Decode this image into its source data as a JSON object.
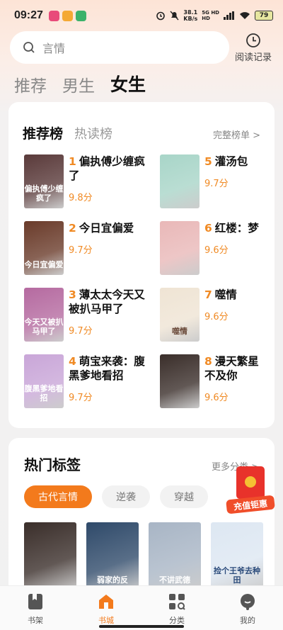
{
  "status_bar": {
    "time": "09:27",
    "net_speed_value": "38.1",
    "net_speed_unit": "KB/s",
    "signal_top": "5G HD",
    "signal_bottom": "HD",
    "battery": "79"
  },
  "search": {
    "placeholder": "言情",
    "history_label": "阅读记录"
  },
  "channel_tabs": [
    {
      "label": "推荐",
      "active": false
    },
    {
      "label": "男生",
      "active": false
    },
    {
      "label": "女生",
      "active": true
    }
  ],
  "rank_card": {
    "tabs": [
      "推荐榜",
      "热读榜"
    ],
    "more_label": "完整榜单 >",
    "items": [
      {
        "num": "1",
        "title": "偏执傅少缠疯了",
        "score": "9.8分",
        "cover_text": "偏执傅少缠疯了",
        "cover_color": "#5a3a3a"
      },
      {
        "num": "2",
        "title": "今日宜偏爱",
        "score": "9.7分",
        "cover_text": "今日宜偏爱",
        "cover_color": "#6a3b2a"
      },
      {
        "num": "3",
        "title": "薄太太今天又被扒马甲了",
        "score": "9.7分",
        "cover_text": "今天又被扒马甲了",
        "cover_color": "#b56aa0"
      },
      {
        "num": "4",
        "title": "萌宝来袭：腹黑爹地看招",
        "score": "9.7分",
        "cover_text": "腹黑爹地看招",
        "cover_color": "#c9a6d8"
      },
      {
        "num": "5",
        "title": "灌汤包",
        "score": "9.7分",
        "cover_text": "",
        "cover_color": "#a8d5c8"
      },
      {
        "num": "6",
        "title": "红楼：梦",
        "score": "9.6分",
        "cover_text": "",
        "cover_color": "#e9b8b8"
      },
      {
        "num": "7",
        "title": "噬情",
        "score": "9.6分",
        "cover_text": "噬情",
        "cover_color": "#efe4d4"
      },
      {
        "num": "8",
        "title": "漫天繁星不及你",
        "score": "9.6分",
        "cover_text": "",
        "cover_color": "#3a2e2a"
      }
    ]
  },
  "tags": {
    "title": "热门标签",
    "more_label": "更多分类 >",
    "chips": [
      {
        "label": "古代言情",
        "active": true
      },
      {
        "label": "逆袭",
        "active": false
      },
      {
        "label": "穿越",
        "active": false
      }
    ],
    "books": [
      {
        "cover_text": "",
        "cover_color": "#3a2e2a"
      },
      {
        "cover_text": "弱家的反",
        "cover_color": "#2f4a6a"
      },
      {
        "cover_text": "不讲武德",
        "cover_color": "#a8b5c5"
      },
      {
        "cover_text": "捡个王爷去种田",
        "cover_color": "#dde7f2"
      }
    ]
  },
  "promo": {
    "label": "充值钜惠"
  },
  "bottom_nav": [
    {
      "label": "书架",
      "icon": "bookshelf-icon",
      "active": false
    },
    {
      "label": "书城",
      "icon": "bookstore-icon",
      "active": true
    },
    {
      "label": "分类",
      "icon": "category-icon",
      "active": false
    },
    {
      "label": "我的",
      "icon": "profile-icon",
      "active": false
    }
  ],
  "colors": {
    "accent": "#f37a1c",
    "score": "#f08a24"
  }
}
